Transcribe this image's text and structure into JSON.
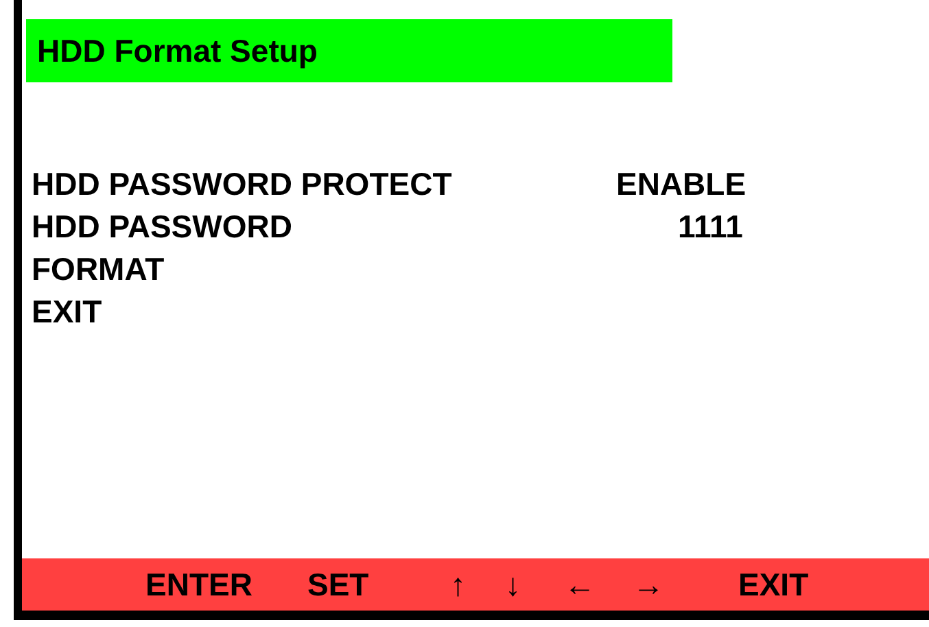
{
  "title": "HDD Format Setup",
  "menu_items": [
    {
      "label": "HDD PASSWORD PROTECT",
      "value": "ENABLE"
    },
    {
      "label": "HDD PASSWORD",
      "value": "1111"
    },
    {
      "label": "FORMAT"
    },
    {
      "label": "EXIT"
    }
  ],
  "footer_keys": [
    "ENTER",
    "SET",
    "↑",
    "↓",
    "←",
    "→",
    "EXIT"
  ]
}
